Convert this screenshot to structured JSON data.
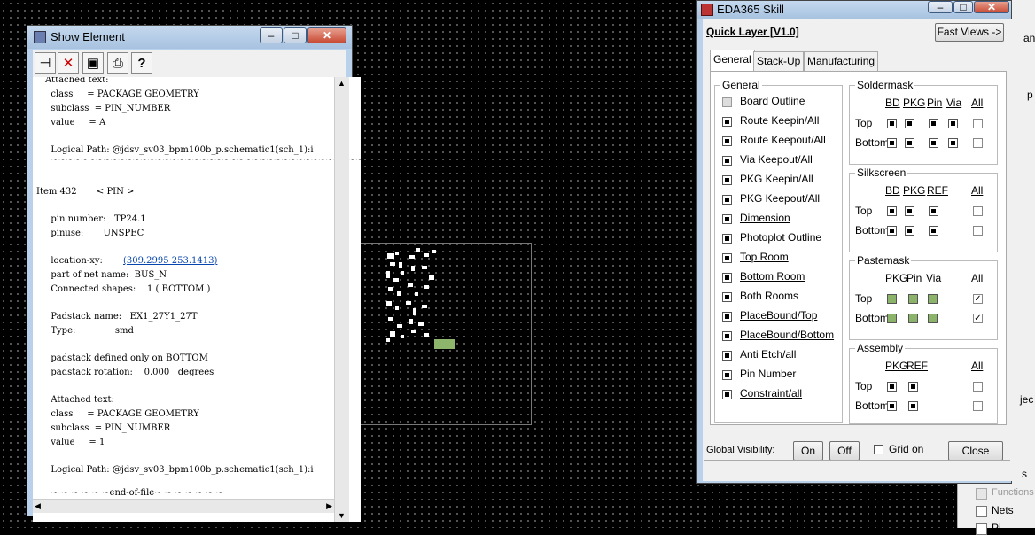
{
  "right_panel": {
    "items": [
      "an",
      "p",
      "jec",
      "s",
      "Functions",
      "Nets",
      "Pi"
    ]
  },
  "show_element": {
    "title": "Show Element",
    "toolbar_icons": [
      "pin-icon",
      "delete-icon",
      "save-icon",
      "print-icon",
      "help-icon"
    ],
    "lines": [
      "Attached text:",
      "  class     = PACKAGE GEOMETRY",
      "  subclass  = PIN_NUMBER",
      "  value     = A",
      "",
      "  Logical Path: @jdsv_sv03_bpm100b_p.schematic1(sch_1):i",
      "  ~~~~~~~~~~~~~~~~~~~~~~~~~~~~~~~~~~~~~~~~~~~~~~~~~~~",
      "",
      "Item 432       < PIN >",
      "",
      "  pin number:   TP24.1",
      "  pinuse:       UNSPEC",
      "",
      "  location-xy:",
      "  part of net name:  BUS_N",
      "  Connected shapes:    1 ( BOTTOM )",
      "",
      "  Padstack name:   EX1_27Y1_27T",
      "  Type:              smd",
      "",
      "  padstack defined only on BOTTOM",
      "  padstack rotation:    0.000   degrees",
      "",
      "  Attached text:",
      "  class     = PACKAGE GEOMETRY",
      "  subclass  = PIN_NUMBER",
      "  value     = 1",
      "",
      "  Logical Path: @jdsv_sv03_bpm100b_p.schematic1(sch_1):i",
      "",
      "  ~ ~ ~ ~ ~ ~end-of-file~ ~ ~ ~ ~ ~ ~"
    ],
    "location_link": "(309.2995 253.1413)"
  },
  "eda": {
    "title": "EDA365 Skill",
    "heading": "Quick Layer [V1.0]",
    "fast_views": "Fast Views ->",
    "tabs": [
      "General",
      "Stack-Up",
      "Manufacturing"
    ],
    "general_group": "General",
    "general_items": [
      {
        "label": "Board Outline",
        "state": "gray",
        "underline": false
      },
      {
        "label": "Route Keepin/All",
        "state": "on",
        "underline": false
      },
      {
        "label": "Route Keepout/All",
        "state": "on",
        "underline": false
      },
      {
        "label": "Via Keepout/All",
        "state": "on",
        "underline": false
      },
      {
        "label": "PKG Keepin/All",
        "state": "on",
        "underline": false
      },
      {
        "label": "PKG Keepout/All",
        "state": "on",
        "underline": false
      },
      {
        "label": "Dimension",
        "state": "on",
        "underline": true
      },
      {
        "label": "Photoplot Outline",
        "state": "on",
        "underline": false
      },
      {
        "label": "Top Room",
        "state": "on",
        "underline": true
      },
      {
        "label": "Bottom Room",
        "state": "on",
        "underline": true
      },
      {
        "label": "Both Rooms",
        "state": "on",
        "underline": false
      },
      {
        "label": "PlaceBound/Top",
        "state": "on",
        "underline": true
      },
      {
        "label": "PlaceBound/Bottom",
        "state": "on",
        "underline": true
      },
      {
        "label": "Anti Etch/all",
        "state": "on",
        "underline": false
      },
      {
        "label": "Pin Number",
        "state": "on",
        "underline": false
      },
      {
        "label": "Constraint/all",
        "state": "on",
        "underline": true
      }
    ],
    "soldermask": {
      "title": "Soldermask",
      "cols": [
        "BD",
        "PKG",
        "Pin",
        "Via",
        "All"
      ],
      "rows": [
        "Top",
        "Bottom"
      ]
    },
    "silkscreen": {
      "title": "Silkscreen",
      "cols": [
        "BD",
        "PKG",
        "REF",
        "All"
      ],
      "rows": [
        "Top",
        "Bottom"
      ]
    },
    "pastemask": {
      "title": "Pastemask",
      "cols": [
        "PKG",
        "Pin",
        "Via",
        "All"
      ],
      "rows": [
        "Top",
        "Bottom"
      ],
      "all_checked": [
        true,
        true
      ]
    },
    "assembly": {
      "title": "Assembly",
      "cols": [
        "PKG",
        "REF",
        "All"
      ],
      "rows": [
        "Top",
        "Bottom"
      ]
    },
    "footer": {
      "global_visibility": "Global Visibility:",
      "on": "On",
      "off": "Off",
      "grid_on": "Grid on",
      "close": "Close"
    }
  }
}
